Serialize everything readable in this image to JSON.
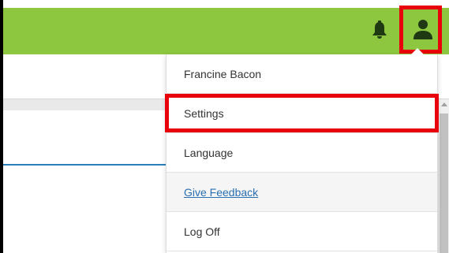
{
  "header": {
    "bar_color": "#8dc63f",
    "notifications_icon": "bell-icon",
    "user_icon": "user-icon"
  },
  "user_menu": {
    "username": "Francine Bacon",
    "items": [
      {
        "label": "Settings"
      },
      {
        "label": "Language"
      },
      {
        "label": "Give Feedback"
      },
      {
        "label": "Log Off"
      }
    ]
  },
  "highlight_color": "#e8000b"
}
